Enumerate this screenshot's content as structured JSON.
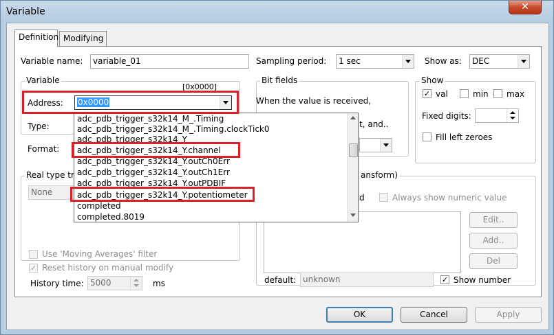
{
  "window": {
    "title": "Variable",
    "close_glyph": "✕"
  },
  "tabs": [
    {
      "label": "Definition"
    },
    {
      "label": "Modifying"
    }
  ],
  "variable_name": {
    "label": "Variable name:",
    "value": "variable_01"
  },
  "sampling_period": {
    "label": "Sampling period:",
    "value": "1 sec"
  },
  "show_as": {
    "label": "Show as:",
    "value": "DEC"
  },
  "variable_group": {
    "title": "Variable",
    "address_hint": "[0x0000]",
    "address_label": "Address:",
    "address_value": "0x0000",
    "type_label": "Type:",
    "format_label": "Format:"
  },
  "address_dropdown": {
    "items": [
      "adc_pdb_trigger_s32k14_M_.Timing",
      "adc_pdb_trigger_s32k14_M_.Timing.clockTick0",
      "adc_pdb_trigger_s32k14_Y",
      "adc_pdb_trigger_s32k14_Y.channel",
      "adc_pdb_trigger_s32k14_Y.outCh0Err",
      "adc_pdb_trigger_s32k14_Y.outCh1Err",
      "adc_pdb_trigger_s32k14_Y.outPDBIF",
      "adc_pdb_trigger_s32k14_Y.potentiometer",
      "completed",
      "completed.8019"
    ]
  },
  "bit_fields": {
    "title": "Bit fields",
    "line1": "When the value is received,",
    "line2_tail": "t, and.."
  },
  "show_group": {
    "title": "Show",
    "val_label": "val",
    "val_checked": true,
    "min_label": "min",
    "min_checked": false,
    "max_label": "max",
    "max_checked": false,
    "fixed_digits_label": "Fixed digits:",
    "fill_zeroes_label": "Fill left zeroes",
    "fill_zeroes_checked": false
  },
  "real_type": {
    "title": "Real type tr",
    "value": "None"
  },
  "transform_group": {
    "title_tail": "ansform)",
    "d_label": "d",
    "always_numeric_label": "Always show numeric value",
    "edit_button": "Edit..",
    "add_button": "Add..",
    "del_button": "Del",
    "default_label": "default:",
    "default_value": "unknown",
    "show_number_label": "Show number",
    "show_number_checked": true
  },
  "options": {
    "moving_avg_label": "Use 'Moving Averages' filter",
    "reset_history_label": "Reset history on manual modify",
    "reset_history_checked": true,
    "history_time_label": "History time:",
    "history_time_value": "5000",
    "history_unit": "ms"
  },
  "footer": {
    "ok": "OK",
    "cancel": "Cancel",
    "apply": "Apply"
  },
  "colors": {
    "highlight": "#d9202b",
    "selection": "#3399ff"
  }
}
